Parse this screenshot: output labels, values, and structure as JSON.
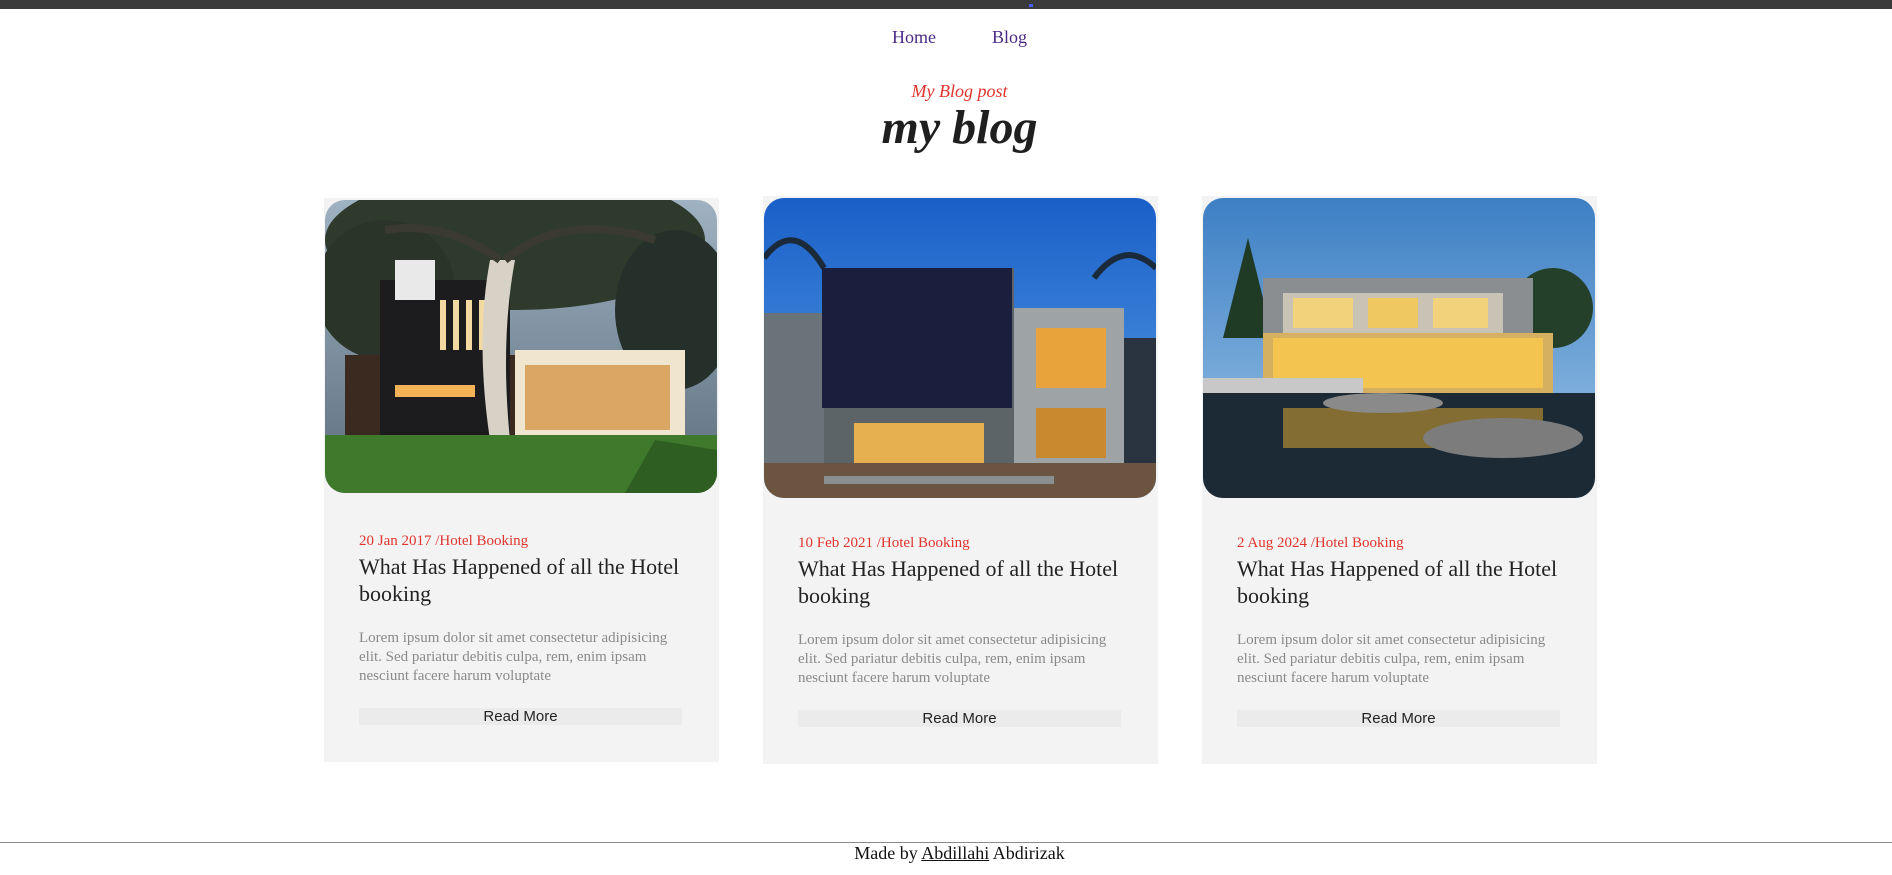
{
  "nav": {
    "home": "Home",
    "blog": "Blog"
  },
  "header": {
    "subtitle": "My Blog post",
    "title": "my blog"
  },
  "posts": [
    {
      "date": "20 Jan 2017",
      "category": " /Hotel Booking",
      "title": "What Has Happened of all the Hotel booking",
      "excerpt": "Lorem ipsum dolor sit amet consectetur adipisicing elit. Sed pariatur debitis culpa, rem, enim ipsam nesciunt facere harum voluptate",
      "button": "Read More",
      "image": "modern-house-with-tree-photo"
    },
    {
      "date": "10 Feb 2021",
      "category": " /Hotel Booking",
      "title": "What Has Happened of all the Hotel booking",
      "excerpt": "Lorem ipsum dolor sit amet consectetur adipisicing elit. Sed pariatur debitis culpa, rem, enim ipsam nesciunt facere harum voluptate",
      "button": "Read More",
      "image": "modern-dark-cube-house-photo"
    },
    {
      "date": "2 Aug 2024",
      "category": " /Hotel Booking",
      "title": "What Has Happened of all the Hotel booking",
      "excerpt": "Lorem ipsum dolor sit amet consectetur adipisicing elit. Sed pariatur debitis culpa, rem, enim ipsam nesciunt facere harum voluptate",
      "button": "Read More",
      "image": "modern-villa-with-pool-photo"
    }
  ],
  "footer": {
    "prefix": "Made by ",
    "author_link": "Abdillahi",
    "suffix": " Abdirizak"
  },
  "colors": {
    "accent": "#e0342e",
    "nav_link": "#4b2a86",
    "card_bg": "#f3f3f3"
  }
}
